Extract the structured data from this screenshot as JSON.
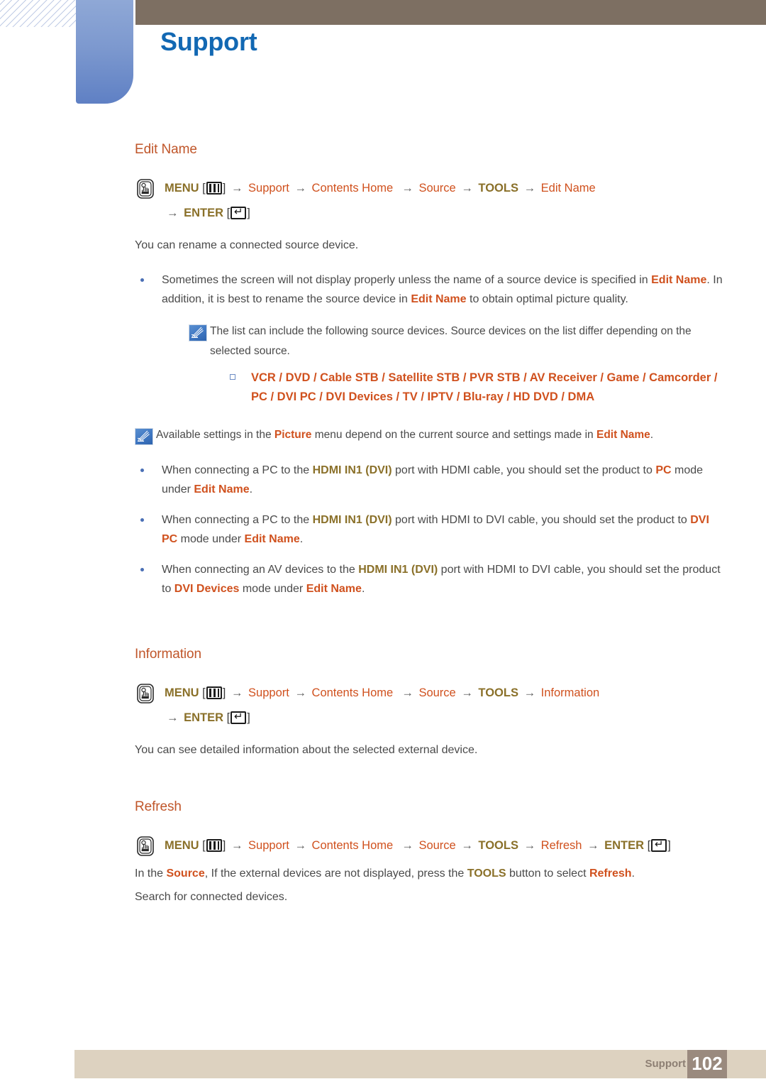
{
  "header": {
    "title": "Support"
  },
  "sections": [
    {
      "heading": "Edit Name",
      "menu_path": {
        "menu_label": "MENU",
        "items": [
          "Support",
          "Contents Home",
          "Source",
          "TOOLS",
          "Edit Name"
        ],
        "tools_label": "TOOLS",
        "enter_label": "ENTER"
      },
      "intro": "You can rename a connected source device."
    },
    {
      "heading": "Information",
      "menu_path": {
        "menu_label": "MENU",
        "items": [
          "Support",
          "Contents Home",
          "Source",
          "TOOLS",
          "Information"
        ],
        "enter_label": "ENTER"
      },
      "intro": "You can see detailed information about the selected external device."
    },
    {
      "heading": "Refresh",
      "menu_path": {
        "menu_label": "MENU",
        "items": [
          "Support",
          "Contents Home",
          "Source",
          "TOOLS",
          "Refresh"
        ],
        "enter_label": "ENTER"
      }
    }
  ],
  "edit_name": {
    "heading": "Edit Name",
    "menu": {
      "menu_label": "MENU",
      "a_support": "Support",
      "a_contents_home": "Contents Home",
      "a_source": "Source",
      "a_tools": "TOOLS",
      "a_target": "Edit Name",
      "enter_label": "ENTER"
    },
    "intro": "You can rename a connected source device.",
    "bullet1": {
      "p1": "Sometimes the screen will not display properly unless the name of a source device is specified in ",
      "k1": "Edit Name",
      "p2": ". In addition, it is best to rename the source device in ",
      "k2": "Edit Name",
      "p3": " to obtain optimal picture quality."
    },
    "note1": "The list can include the following source devices. Source devices on the list differ depending on the selected source.",
    "device_list": {
      "line1": "VCR / DVD / Cable STB / Satellite STB / PVR STB / AV Receiver / Game / Camcorder /",
      "line2": "PC / DVI PC / DVI Devices / TV / IPTV / Blu-ray / HD DVD / DMA"
    },
    "note2": {
      "p1": "Available settings in the ",
      "k1": "Picture",
      "p2": " menu depend on the current source and settings made in ",
      "k2": "Edit Name",
      "p3": "."
    },
    "bullet2": {
      "p1": "When connecting a PC to the ",
      "g1": "HDMI IN1 (DVI)",
      "p2": " port with HDMI cable, you should set the product to ",
      "k1": "PC",
      "p3": " mode under ",
      "k2": "Edit Name",
      "p4": "."
    },
    "bullet3": {
      "p1": "When connecting a PC to the ",
      "g1": "HDMI IN1 (DVI)",
      "p2": " port with HDMI to DVI cable, you should set the product to ",
      "k1": "DVI PC",
      "p3": " mode under ",
      "k2": "Edit Name",
      "p4": "."
    },
    "bullet4": {
      "p1": "When connecting an AV devices to the ",
      "g1": "HDMI IN1 (DVI)",
      "p2": " port with HDMI to DVI cable, you should set the product to ",
      "k1": "DVI Devices",
      "p3": " mode under ",
      "k2": "Edit Name",
      "p4": "."
    }
  },
  "information": {
    "heading": "Information",
    "menu": {
      "menu_label": "MENU",
      "a_support": "Support",
      "a_contents_home": "Contents Home",
      "a_source": "Source",
      "a_tools": "TOOLS",
      "a_target": "Information",
      "enter_label": "ENTER"
    },
    "intro": "You can see detailed information about the selected external device."
  },
  "refresh": {
    "heading": "Refresh",
    "menu": {
      "menu_label": "MENU",
      "a_support": "Support",
      "a_contents_home": "Contents Home",
      "a_source": "Source",
      "a_tools": "TOOLS",
      "a_target": "Refresh",
      "enter_label": "ENTER"
    },
    "body": {
      "p1": "In the ",
      "k1": "Source",
      "p2": ", If the external devices are not displayed, press the ",
      "g1": "TOOLS",
      "p3": " button to select ",
      "k2": "Refresh",
      "p4": "."
    },
    "body2": "Search for connected devices."
  },
  "footer": {
    "label": "Support",
    "page_number": "102"
  },
  "colors": {
    "accent_orange": "#d0511e",
    "heading_orange": "#c0562a",
    "gold": "#8a7029",
    "title_blue": "#1268b3",
    "header_brown": "#7d6f62",
    "footer_bar": "#ddd2c0",
    "footer_page_box": "#9a8a7e",
    "bullet_blue": "#4a6fb5"
  }
}
